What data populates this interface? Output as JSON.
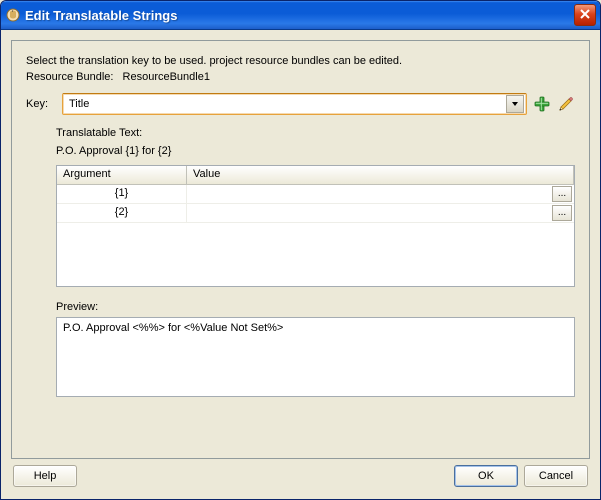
{
  "window": {
    "title": "Edit Translatable Strings"
  },
  "instruction": "Select the translation key to be used. project resource bundles can be edited.",
  "resource_bundle_label": "Resource Bundle:",
  "resource_bundle_name": "ResourceBundle1",
  "key_label": "Key:",
  "key_value": "Title",
  "translatable_text_label": "Translatable Text:",
  "translatable_text_value": "P.O. Approval {1} for {2}",
  "table": {
    "headers": {
      "argument": "Argument",
      "value": "Value"
    },
    "rows": [
      {
        "argument": "{1}",
        "value": ""
      },
      {
        "argument": "{2}",
        "value": ""
      }
    ]
  },
  "preview_label": "Preview:",
  "preview_text": "P.O. Approval <%%> for <%Value Not Set%>",
  "buttons": {
    "help": "Help",
    "ok": "OK",
    "cancel": "Cancel"
  },
  "icons": {
    "add": "add-icon",
    "edit": "pencil-icon",
    "close": "close-icon"
  }
}
